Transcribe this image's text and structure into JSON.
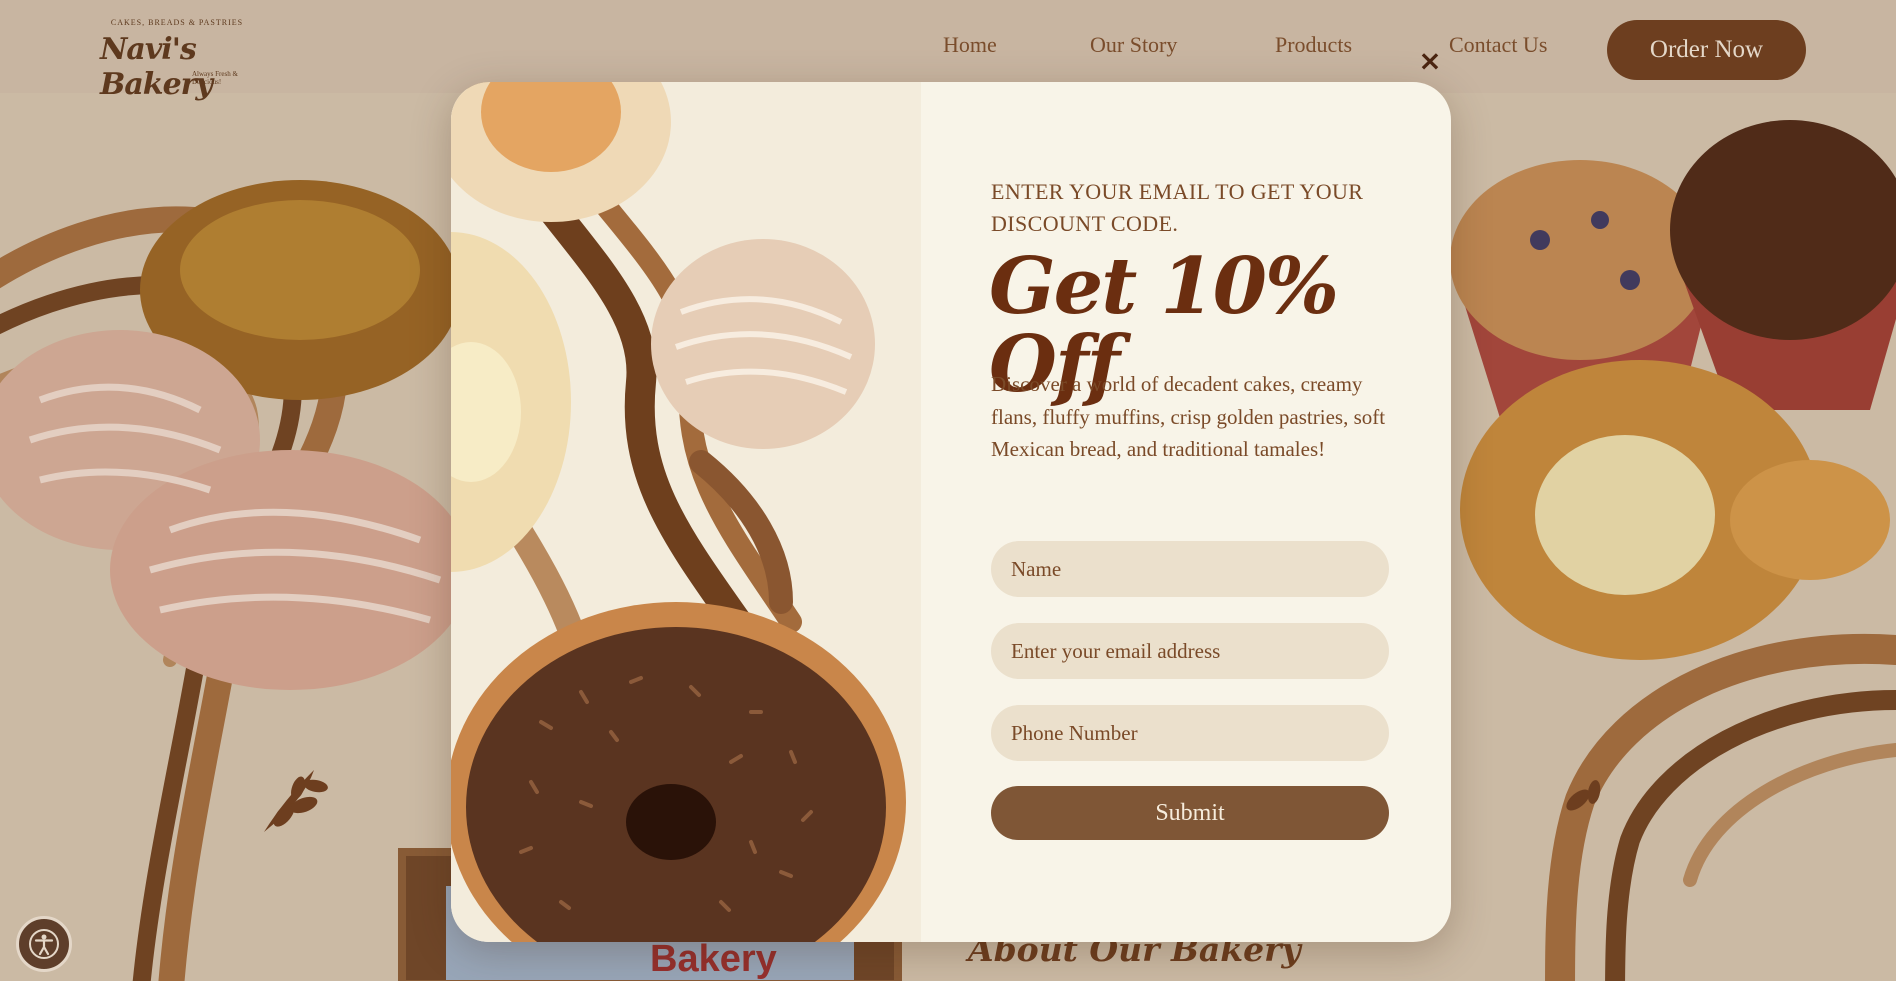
{
  "header": {
    "logo_arc": "CAKES, BREADS & PASTRIES",
    "logo_name": "Navi's Bakery",
    "logo_tagline": "Always Fresh & Delicious!",
    "nav": [
      {
        "label": "Home"
      },
      {
        "label": "Our Story"
      },
      {
        "label": "Products"
      },
      {
        "label": "Contact Us"
      }
    ],
    "order_label": "Order Now"
  },
  "page": {
    "about_title": "About Our Bakery",
    "frame_text": "Bakery"
  },
  "modal": {
    "close_glyph": "×",
    "kicker": "ENTER YOUR EMAIL TO GET YOUR DISCOUNT CODE.",
    "headline": "Get 10% Off",
    "description": "Discover a world of decadent cakes, creamy flans, fluffy muffins, crisp golden pastries, soft Mexican bread, and traditional tamales!",
    "fields": {
      "name_placeholder": "Name",
      "email_placeholder": "Enter your email address",
      "phone_placeholder": "Phone Number"
    },
    "submit_label": "Submit"
  },
  "colors": {
    "brand_brown": "#6b3a1a",
    "background": "#d6c6b1",
    "modal_bg": "#f8f4e8",
    "field_bg": "#ebe0cc",
    "submit_bg": "#7f5636"
  },
  "icons": [
    "close-icon",
    "accessibility-icon",
    "wheat-leaf-icon"
  ]
}
